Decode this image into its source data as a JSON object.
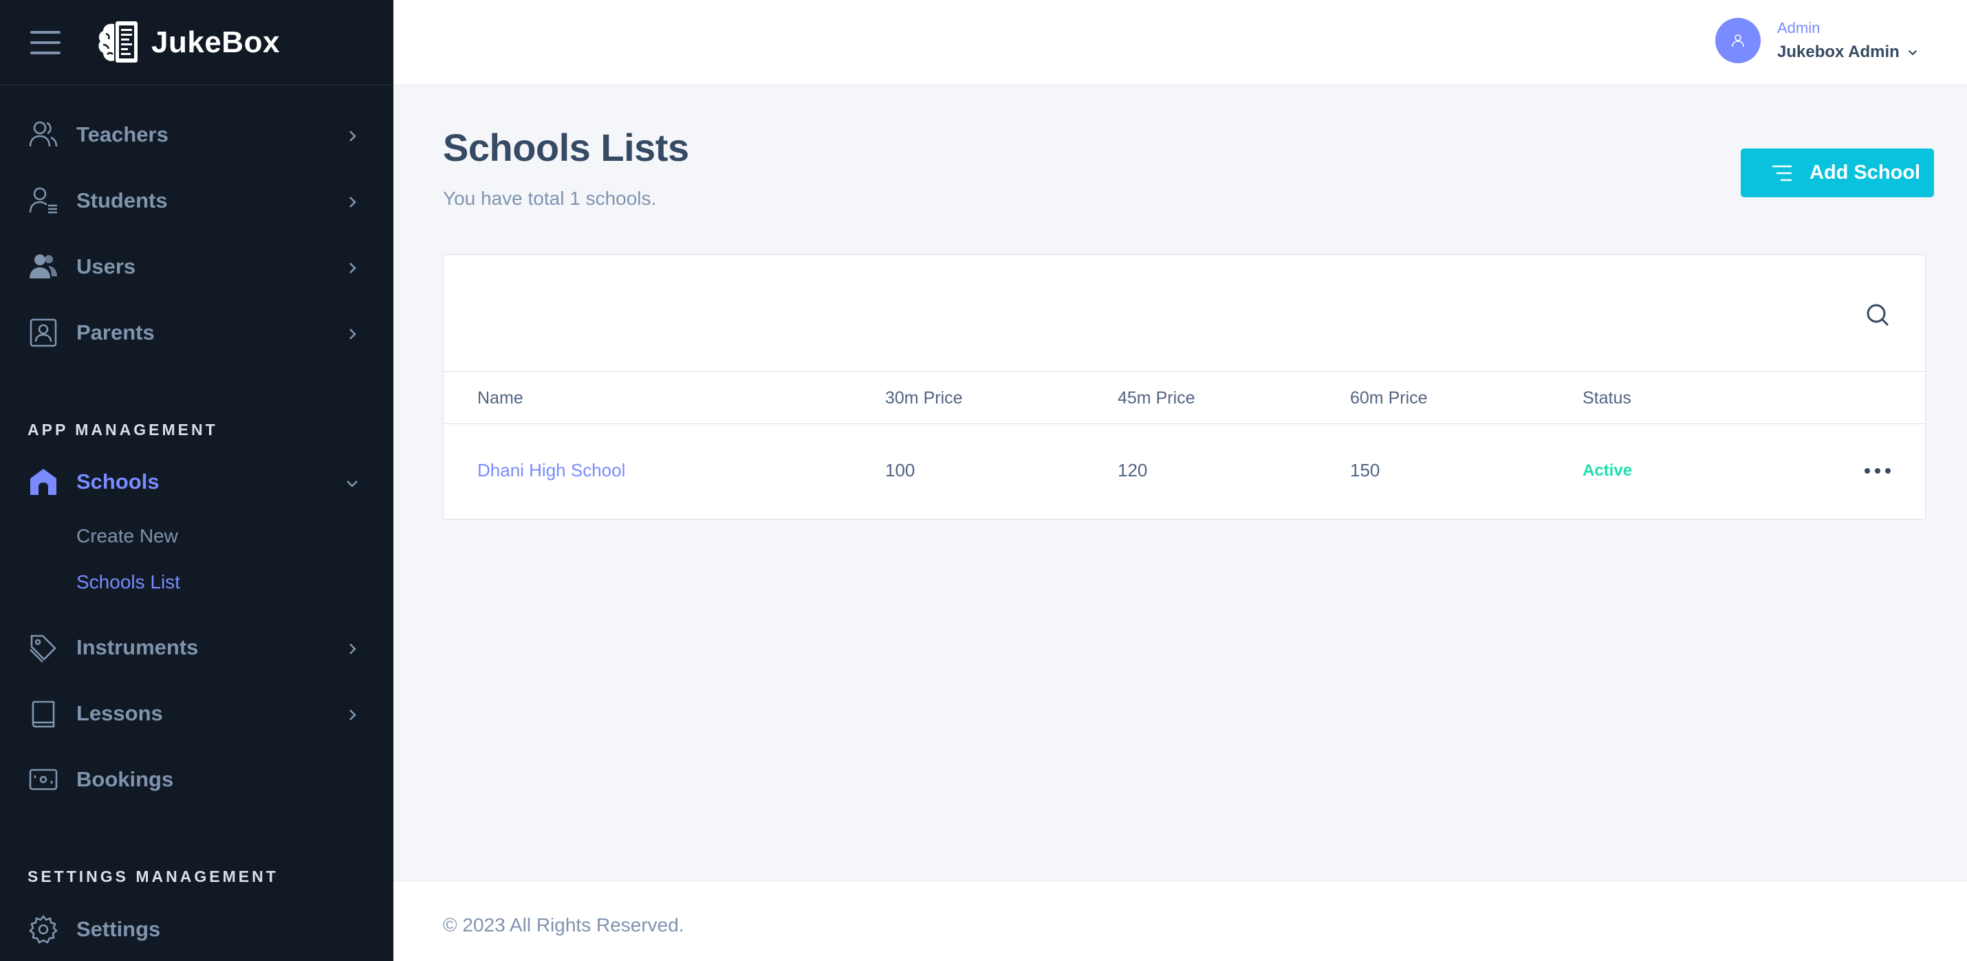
{
  "brand": {
    "name": "JukeBox"
  },
  "sidebar": {
    "items": [
      {
        "label": "Teachers",
        "icon": "users-icon"
      },
      {
        "label": "Students",
        "icon": "user-list-icon"
      },
      {
        "label": "Users",
        "icon": "users-fill-icon"
      },
      {
        "label": "Parents",
        "icon": "user-card-icon"
      }
    ],
    "app_section": "APP MANAGEMENT",
    "schools": {
      "label": "Schools",
      "icon": "home-icon"
    },
    "sub_items": [
      {
        "label": "Create New"
      },
      {
        "label": "Schools List"
      }
    ],
    "items2": [
      {
        "label": "Instruments",
        "icon": "tag-icon"
      },
      {
        "label": "Lessons",
        "icon": "book-icon"
      },
      {
        "label": "Bookings",
        "icon": "money-icon"
      }
    ],
    "settings_section": "SETTINGS MANAGEMENT",
    "settings": {
      "label": "Settings",
      "icon": "gear-icon"
    }
  },
  "header": {
    "user_role": "Admin",
    "user_name": "Jukebox Admin"
  },
  "page": {
    "title": "Schools Lists",
    "subtitle": "You have total 1 schools.",
    "add_button": "Add School"
  },
  "table": {
    "columns": [
      "Name",
      "30m Price",
      "45m Price",
      "60m Price",
      "Status"
    ],
    "rows": [
      {
        "name": "Dhani High School",
        "p30": "100",
        "p45": "120",
        "p60": "150",
        "status": "Active"
      }
    ]
  },
  "footer": {
    "text": "© 2023 All Rights Reserved."
  },
  "colors": {
    "sidebar_bg": "#101924",
    "accent": "#798bff",
    "button": "#09c2de",
    "status_active": "#1ee0ac"
  }
}
